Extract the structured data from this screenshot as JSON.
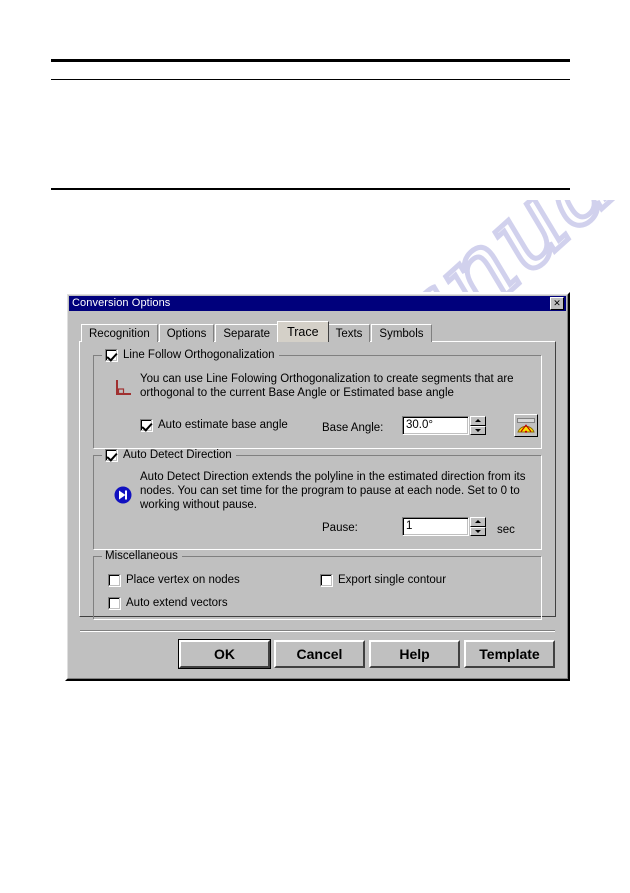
{
  "page": {
    "rules": [
      "thick-rule-top",
      "thin-rule",
      "mid-rule"
    ],
    "watermark": "manualarchive.com"
  },
  "dialog": {
    "title": "Conversion Options",
    "close_label": "✕",
    "tabs": [
      {
        "label": "Recognition",
        "active": false
      },
      {
        "label": "Options",
        "active": false
      },
      {
        "label": "Separate",
        "active": false
      },
      {
        "label": "Trace",
        "active": true
      },
      {
        "label": "Texts",
        "active": false
      },
      {
        "label": "Symbols",
        "active": false
      }
    ],
    "groups": {
      "orthogonalization": {
        "caption": "Line Follow Orthogonalization",
        "caption_checked": true,
        "description": "You can use Line Folowing Orthogonalization to create segments that are orthogonal to the current Base Angle or Estimated base angle",
        "auto_estimate": {
          "label": "Auto estimate base angle",
          "checked": true
        },
        "base_angle_label": "Base Angle:",
        "base_angle_value": "30.0°",
        "tool_button_icon": "angle-measure-icon"
      },
      "auto_detect": {
        "caption": "Auto Detect Direction",
        "caption_checked": true,
        "description": "Auto Detect Direction extends the polyline in the estimated direction from its nodes. You can set time for the program to pause at each node. Set to 0 to working without pause.",
        "pause_label": "Pause:",
        "pause_value": "1",
        "pause_units": "sec"
      },
      "miscellaneous": {
        "caption": "Miscellaneous",
        "items": [
          {
            "label": "Place vertex on nodes",
            "checked": false
          },
          {
            "label": "Auto extend vectors",
            "checked": false
          },
          {
            "label": "Export single contour",
            "checked": false
          }
        ]
      }
    },
    "buttons": [
      {
        "label": "OK",
        "default": true
      },
      {
        "label": "Cancel",
        "default": false
      },
      {
        "label": "Help",
        "default": false
      },
      {
        "label": "Template",
        "default": false
      }
    ]
  },
  "colors": {
    "titlebar": "#00007C",
    "dialog_face": "#C0C0C0",
    "orth_icon": "#A03030",
    "dir_icon": "#1010C0",
    "tool_icon": "#FFE000",
    "watermark": "#C9C9EA"
  }
}
